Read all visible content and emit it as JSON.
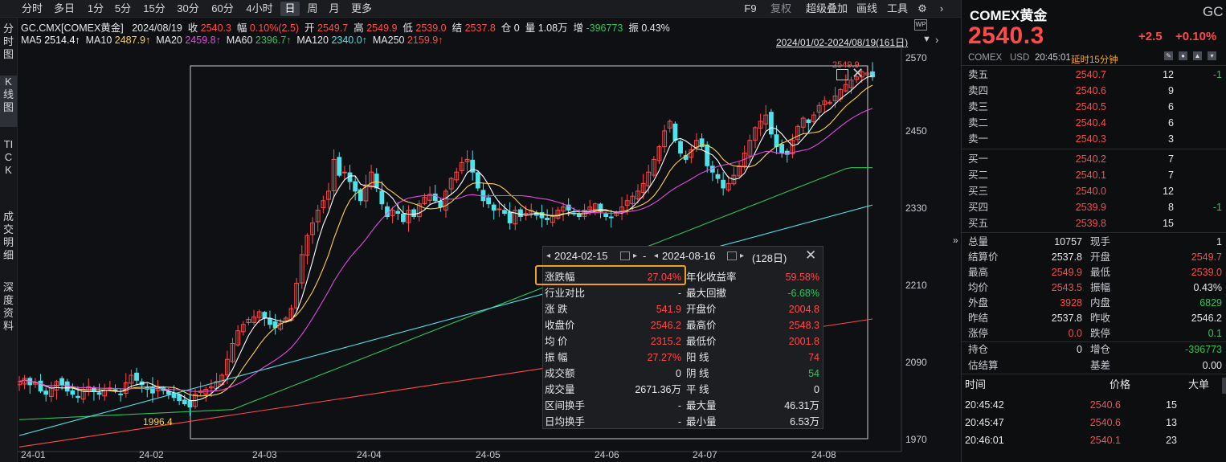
{
  "toolbar": {
    "periods": [
      "分时",
      "多日",
      "1分",
      "5分",
      "15分",
      "30分",
      "60分",
      "4小时",
      "日",
      "周",
      "月",
      "更多"
    ],
    "active_period": "日",
    "right_items": [
      "F9",
      "复权",
      "超级叠加",
      "画线",
      "工具"
    ]
  },
  "left_tabs": [
    "分时图",
    "K线图",
    "TICK",
    "成交明细",
    "深度资料"
  ],
  "info": {
    "symbol": "GC.CMX[COMEX黄金]",
    "date": "2024/08/19",
    "close_label": "收",
    "close": "2540.3",
    "amp_label": "幅",
    "amp": "0.10%(2.5)",
    "open_label": "开",
    "open": "2549.7",
    "high_label": "高",
    "high": "2549.9",
    "low_label": "低",
    "low": "2539.0",
    "settle_label": "结",
    "settle": "2537.8",
    "oi_label": "仓",
    "oi": "0",
    "vol_label": "量",
    "vol": "1.08万",
    "inc_label": "增",
    "inc": "-396773",
    "swing_label": "振",
    "swing": "0.43%"
  },
  "ma": [
    {
      "label": "MA5",
      "value": "2514.4↑",
      "color": "#ffffff"
    },
    {
      "label": "MA10",
      "value": "2487.9↑",
      "color": "#ffd24a"
    },
    {
      "label": "MA20",
      "value": "2459.8↑",
      "color": "#e44ae0"
    },
    {
      "label": "MA60",
      "value": "2396.7↑",
      "color": "#2fc45c"
    },
    {
      "label": "MA120",
      "value": "2340.0↑",
      "color": "#4ee3ea"
    },
    {
      "label": "MA250",
      "value": "2159.9↑",
      "color": "#ff4a4a"
    }
  ],
  "range_text": "2024/01/02-2024/08/19(161日)",
  "chart_data": {
    "type": "candlestick",
    "y_ticks": [
      "2570",
      "2450",
      "2330",
      "2210",
      "2090",
      "1970"
    ],
    "x_ticks": [
      "24-01",
      "24-02",
      "24-03",
      "24-04",
      "24-05",
      "24-06",
      "24-07",
      "24-08"
    ],
    "ylim": [
      1970,
      2570
    ],
    "annotations": {
      "high_label": "2549.9",
      "low_label": "1996.4"
    }
  },
  "popup": {
    "start_date": "2024-02-15",
    "end_date": "2024-08-16",
    "dash": "-",
    "days": "(128日)",
    "rows": [
      [
        "涨跌幅",
        "27.04%",
        "年化收益率",
        "59.58%"
      ],
      [
        "行业对比",
        "-",
        "最大回撤",
        "-6.68%"
      ],
      [
        "涨 跌",
        "541.9",
        "开盘价",
        "2004.8"
      ],
      [
        "收盘价",
        "2546.2",
        "最高价",
        "2548.3"
      ],
      [
        "均 价",
        "2315.2",
        "最低价",
        "2001.8"
      ],
      [
        "振 幅",
        "27.27%",
        "阳 线",
        "74"
      ],
      [
        "成交额",
        "0",
        "阴 线",
        "54"
      ],
      [
        "成交量",
        "2671.36万",
        "平 线",
        "0"
      ],
      [
        "区间换手",
        "-",
        "最大量",
        "46.31万"
      ],
      [
        "日均换手",
        "-",
        "最小量",
        "6.53万"
      ]
    ]
  },
  "quote": {
    "name": "COMEX黄金",
    "code": "GC",
    "price": "2540.3",
    "change": "+2.5",
    "change_pct": "+0.10%",
    "exchange": "COMEX",
    "currency": "USD",
    "time": "20:45:01",
    "delay": "延时15分钟"
  },
  "book": {
    "asks": [
      {
        "label": "卖五",
        "price": "2540.7",
        "vol": "12",
        "chg": "-1"
      },
      {
        "label": "卖四",
        "price": "2540.6",
        "vol": "9",
        "chg": ""
      },
      {
        "label": "卖三",
        "price": "2540.5",
        "vol": "6",
        "chg": ""
      },
      {
        "label": "卖二",
        "price": "2540.4",
        "vol": "6",
        "chg": ""
      },
      {
        "label": "卖一",
        "price": "2540.3",
        "vol": "3",
        "chg": ""
      }
    ],
    "bids": [
      {
        "label": "买一",
        "price": "2540.2",
        "vol": "7",
        "chg": ""
      },
      {
        "label": "买二",
        "price": "2540.1",
        "vol": "7",
        "chg": ""
      },
      {
        "label": "买三",
        "price": "2540.0",
        "vol": "12",
        "chg": ""
      },
      {
        "label": "买四",
        "price": "2539.9",
        "vol": "8",
        "chg": "-1"
      },
      {
        "label": "买五",
        "price": "2539.8",
        "vol": "15",
        "chg": ""
      }
    ]
  },
  "stats": [
    [
      "总量",
      "10757",
      "现手",
      "1"
    ],
    [
      "结算价",
      "2537.8",
      "开盘",
      "2549.7"
    ],
    [
      "最高",
      "2549.9",
      "最低",
      "2539.0"
    ],
    [
      "均价",
      "2543.5",
      "振幅",
      "0.43%"
    ],
    [
      "外盘",
      "3928",
      "内盘",
      "6829"
    ],
    [
      "昨结",
      "2537.8",
      "昨收",
      "2546.2"
    ],
    [
      "涨停",
      "0.0",
      "跌停",
      "0.1"
    ]
  ],
  "stats2": [
    [
      "持仓",
      "0",
      "增仓",
      "-396773"
    ],
    [
      "估结算",
      "",
      "基差",
      "0.00"
    ]
  ],
  "ticks_header": [
    "时间",
    "价格",
    "大单"
  ],
  "ticks": [
    [
      "20:45:42",
      "2540.6",
      "15"
    ],
    [
      "20:45:47",
      "2540.6",
      "13"
    ],
    [
      "20:46:01",
      "2540.1",
      "23"
    ]
  ],
  "colors": {
    "up": "#ff4a4a",
    "down": "#2fc45c",
    "highlight": "#f0a020",
    "accent": "#f5a623"
  }
}
